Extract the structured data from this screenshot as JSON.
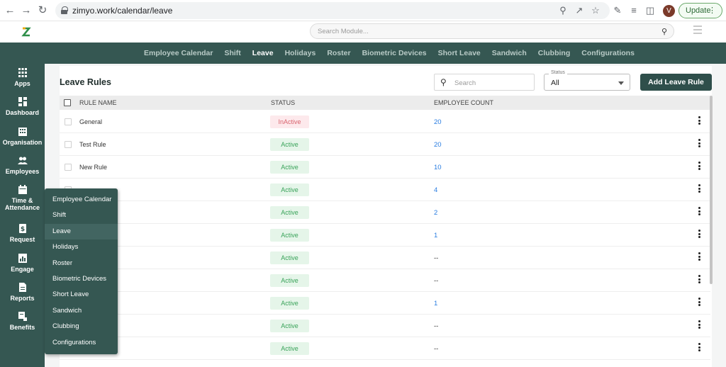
{
  "browser": {
    "url": "zimyo.work/calendar/leave",
    "avatar_letter": "V",
    "update_label": "Update"
  },
  "header": {
    "search_placeholder": "Search Module..."
  },
  "subnav": {
    "tabs": [
      {
        "label": "Employee Calendar",
        "active": false
      },
      {
        "label": "Shift",
        "active": false
      },
      {
        "label": "Leave",
        "active": true
      },
      {
        "label": "Holidays",
        "active": false
      },
      {
        "label": "Roster",
        "active": false
      },
      {
        "label": "Biometric Devices",
        "active": false
      },
      {
        "label": "Short Leave",
        "active": false
      },
      {
        "label": "Sandwich",
        "active": false
      },
      {
        "label": "Clubbing",
        "active": false
      },
      {
        "label": "Configurations",
        "active": false
      }
    ]
  },
  "sidebar": {
    "items": [
      {
        "label": "Apps",
        "icon": "apps-grid-icon"
      },
      {
        "label": "Dashboard",
        "icon": "dashboard-icon"
      },
      {
        "label": "Organisation",
        "icon": "organisation-icon"
      },
      {
        "label": "Employees",
        "icon": "employees-icon"
      },
      {
        "label": "Time &",
        "label2": "Attendance",
        "icon": "calendar-icon"
      },
      {
        "label": "Request",
        "icon": "request-icon"
      },
      {
        "label": "Engage",
        "icon": "engage-icon"
      },
      {
        "label": "Reports",
        "icon": "reports-icon"
      },
      {
        "label": "Benefits",
        "icon": "benefits-icon"
      }
    ]
  },
  "page": {
    "title": "Leave Rules",
    "search_placeholder": "Search",
    "status_label": "Status",
    "status_value": "All",
    "add_button": "Add Leave Rule"
  },
  "table": {
    "headers": [
      "RULE NAME",
      "STATUS",
      "EMPLOYEE COUNT"
    ],
    "rows": [
      {
        "name": "General",
        "status": "InActive",
        "count": "20"
      },
      {
        "name": "Test Rule",
        "status": "Active",
        "count": "20"
      },
      {
        "name": "New Rule",
        "status": "Active",
        "count": "10"
      },
      {
        "name": "",
        "status": "Active",
        "count": "4"
      },
      {
        "name": "",
        "status": "Active",
        "count": "2"
      },
      {
        "name": "",
        "status": "Active",
        "count": "1"
      },
      {
        "name": "",
        "status": "Active",
        "count": "--"
      },
      {
        "name": "",
        "status": "Active",
        "count": "--"
      },
      {
        "name": "",
        "status": "Active",
        "count": "1"
      },
      {
        "name": "",
        "status": "Active",
        "count": "--"
      },
      {
        "name": "",
        "status": "Active",
        "count": "--"
      }
    ]
  },
  "dropdown": {
    "items": [
      {
        "label": "Employee Calendar",
        "active": false
      },
      {
        "label": "Shift",
        "active": false
      },
      {
        "label": "Leave",
        "active": true
      },
      {
        "label": "Holidays",
        "active": false
      },
      {
        "label": "Roster",
        "active": false
      },
      {
        "label": "Biometric Devices",
        "active": false
      },
      {
        "label": "Short Leave",
        "active": false
      },
      {
        "label": "Sandwich",
        "active": false
      },
      {
        "label": "Clubbing",
        "active": false
      },
      {
        "label": "Configurations",
        "active": false
      }
    ]
  }
}
